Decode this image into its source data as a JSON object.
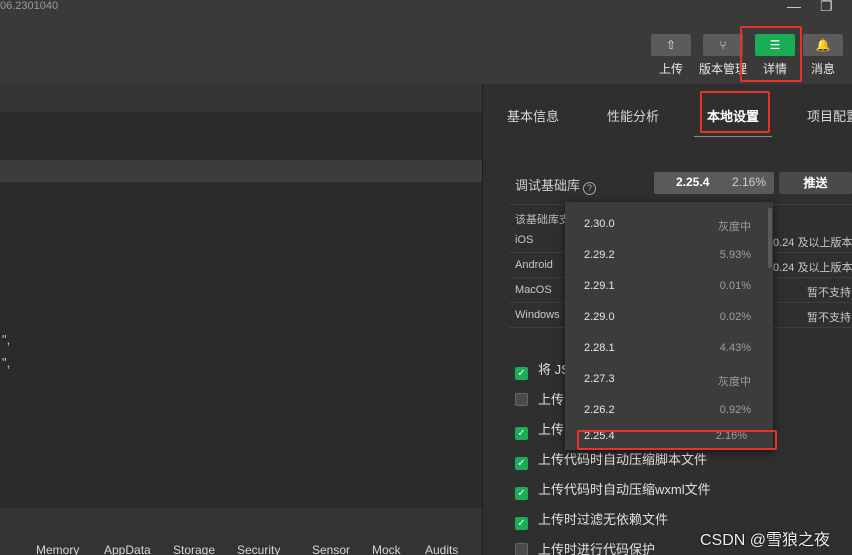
{
  "window": {
    "version_text": "06.2301040",
    "minimize_glyph": "—",
    "restore_glyph": "❐"
  },
  "toolbar": {
    "buttons": [
      {
        "label": "上传",
        "icon": "upload-icon",
        "glyph": "⇧"
      },
      {
        "label": "版本管理",
        "icon": "branch-icon",
        "glyph": "⑂"
      },
      {
        "label": "详情",
        "icon": "menu-icon",
        "glyph": "☰"
      },
      {
        "label": "消息",
        "icon": "bell-icon",
        "glyph": "🔔"
      }
    ]
  },
  "editor": {
    "code_lines": [
      "\",",
      "\","
    ]
  },
  "bottom_tabs": [
    "Memory",
    "AppData",
    "Storage",
    "Security",
    "Sensor",
    "Mock",
    "Audits"
  ],
  "details": {
    "tabs": [
      "基本信息",
      "性能分析",
      "本地设置",
      "项目配置"
    ],
    "active_tab": "本地设置",
    "debug_lib_label": "调试基础库",
    "help_glyph": "?",
    "selected_version": "2.25.4",
    "selected_percent": "2.16%",
    "push_label": "推送",
    "support_note": "该基础库支",
    "platforms": [
      {
        "name": "iOS",
        "value": "0.24 及以上版本"
      },
      {
        "name": "Android",
        "value": "0.24 及以上版本"
      },
      {
        "name": "MacOS",
        "value": "暂不支持"
      },
      {
        "name": "Windows",
        "value": "暂不支持"
      }
    ],
    "checkboxes": [
      {
        "label": "将 JS",
        "checked": true
      },
      {
        "label": "上传",
        "checked": false
      },
      {
        "label": "上传",
        "checked": true
      },
      {
        "label": "上传代码时自动压缩脚本文件",
        "checked": true
      },
      {
        "label": "上传代码时自动压缩wxml文件",
        "checked": true
      },
      {
        "label": "上传时过滤无依赖文件",
        "checked": true
      },
      {
        "label": "上传时进行代码保护",
        "checked": false
      }
    ],
    "check_glyph": "✓"
  },
  "version_dropdown": [
    {
      "version": "2.30.0",
      "percent": "灰度中"
    },
    {
      "version": "2.29.2",
      "percent": "5.93%"
    },
    {
      "version": "2.29.1",
      "percent": "0.01%"
    },
    {
      "version": "2.29.0",
      "percent": "0.02%"
    },
    {
      "version": "2.28.1",
      "percent": "4.43%"
    },
    {
      "version": "2.27.3",
      "percent": "灰度中"
    },
    {
      "version": "2.26.2",
      "percent": "0.92%"
    },
    {
      "version": "2.25.4",
      "percent": "2.16%"
    }
  ],
  "watermark": "CSDN @雪狼之夜"
}
